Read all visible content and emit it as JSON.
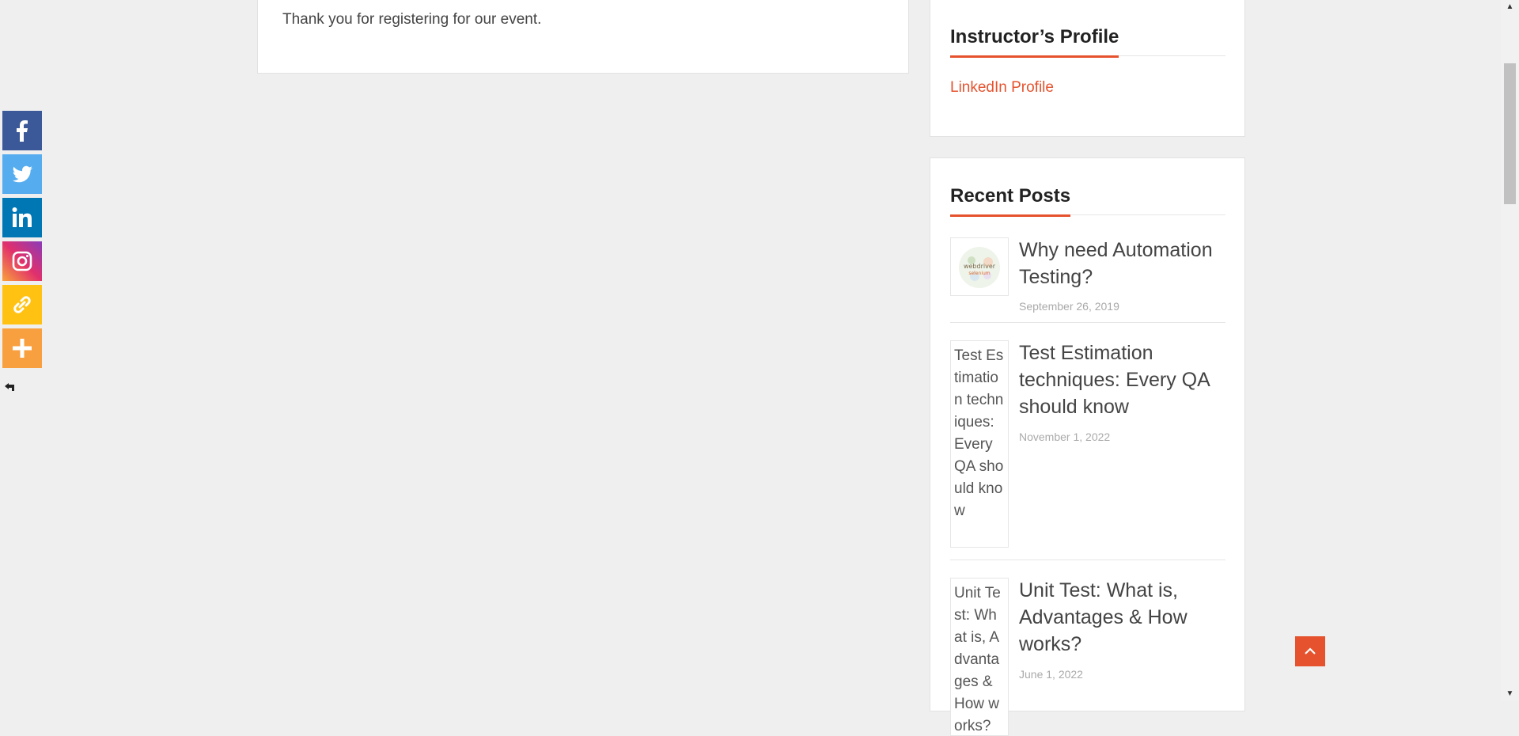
{
  "main": {
    "message": "Thank you for registering for our event."
  },
  "profile_widget": {
    "title": "Instructor’s Profile",
    "link_label": "LinkedIn Profile"
  },
  "posts_widget": {
    "title": "Recent Posts",
    "posts": [
      {
        "title": "Why need Automation Testing?",
        "date": "September 26, 2019",
        "thumb_alt": ""
      },
      {
        "title": "Test Estimation techniques: Every QA should know",
        "date": "November 1, 2022",
        "thumb_alt": "Test Estimation techniques: Every QA should know"
      },
      {
        "title": "Unit Test: What is, Advantages & How works?",
        "date": "June 1, 2022",
        "thumb_alt": "Unit Test: What is, Advantages & How works?"
      }
    ]
  },
  "share_bar": {
    "buttons": [
      {
        "icon": "facebook-icon",
        "color": "#3b5998"
      },
      {
        "icon": "twitter-icon",
        "color": "#55acee"
      },
      {
        "icon": "linkedin-icon",
        "color": "#0077b5"
      },
      {
        "icon": "instagram-icon",
        "color": "#e1306c"
      },
      {
        "icon": "copy-link-icon",
        "color": "#ffc112"
      },
      {
        "icon": "more-icon",
        "color": "#f8a040"
      }
    ]
  },
  "colors": {
    "accent": "#e5522d",
    "background": "#efefef"
  }
}
